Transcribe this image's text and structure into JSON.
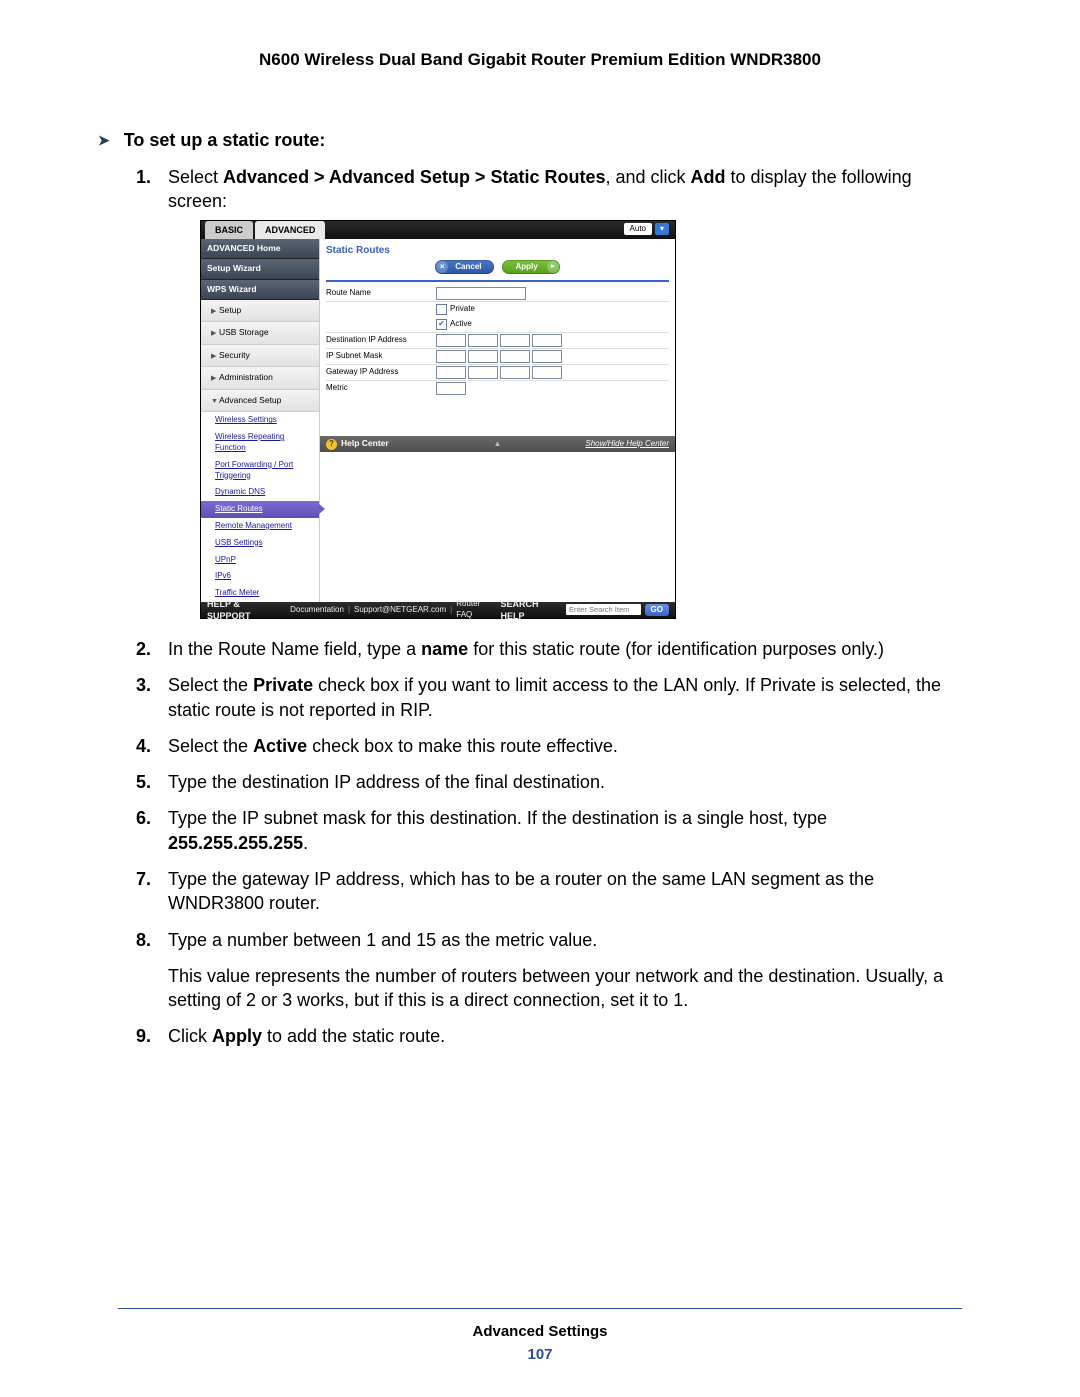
{
  "header": "N600 Wireless Dual Band Gigabit Router Premium Edition WNDR3800",
  "heading": "To set up a static route:",
  "steps": {
    "s1a": "Select ",
    "s1b": "Advanced > Advanced Setup > Static Routes",
    "s1c": ", and click ",
    "s1d": "Add",
    "s1e": " to display the following screen:",
    "s2a": "In the Route Name field, type a ",
    "s2b": "name",
    "s2c": " for this static route (for identification purposes only.)",
    "s3a": "Select the ",
    "s3b": "Private",
    "s3c": " check box if you want to limit access to the LAN only. If Private is selected, the static route is not reported in RIP.",
    "s4a": "Select the ",
    "s4b": "Active",
    "s4c": " check box to make this route effective.",
    "s5": "Type the destination IP address of the final destination.",
    "s6a": "Type the IP subnet mask for this destination. If the destination is a single host, type ",
    "s6b": "255.255.255.255",
    "s6c": ".",
    "s7": "Type the gateway IP address, which has to be a router on the same LAN segment as the WNDR3800 router.",
    "s8a": "Type a number between 1 and 15 as the metric value.",
    "s8b": "This value represents the number of routers between your network and the destination. Usually, a setting of 2 or 3 works, but if this is a direct connection, set it to 1.",
    "s9a": "Click ",
    "s9b": "Apply",
    "s9c": " to add the static route."
  },
  "footer": {
    "label": "Advanced Settings",
    "page": "107"
  },
  "ui": {
    "tabs": {
      "basic": "BASIC",
      "advanced": "ADVANCED"
    },
    "auto": "Auto",
    "sidebar": {
      "home": "ADVANCED Home",
      "setup_wizard": "Setup Wizard",
      "wps": "WPS Wizard",
      "setup": "Setup",
      "usb": "USB Storage",
      "security": "Security",
      "admin": "Administration",
      "adv_setup": "Advanced Setup",
      "subs": {
        "wireless": "Wireless Settings",
        "repeating": "Wireless Repeating Function",
        "portfwd": "Port Forwarding / Port Triggering",
        "ddns": "Dynamic DNS",
        "static": "Static Routes",
        "remote": "Remote Management",
        "usbset": "USB Settings",
        "upnp": "UPnP",
        "ipv6": "IPv6",
        "traffic": "Traffic Meter"
      }
    },
    "main": {
      "title": "Static Routes",
      "cancel": "Cancel",
      "apply": "Apply",
      "route_name": "Route Name",
      "private": "Private",
      "active": "Active",
      "dest": "Destination IP Address",
      "mask": "IP Subnet Mask",
      "gw": "Gateway IP Address",
      "metric": "Metric"
    },
    "help": {
      "title": "Help Center",
      "show": "Show/Hide Help Center"
    },
    "footer": {
      "hs": "HELP & SUPPORT",
      "doc": "Documentation",
      "sup": "Support@NETGEAR.com",
      "faq": "Router FAQ",
      "sh": "SEARCH HELP",
      "placeholder": "Enter Search Item",
      "go": "GO"
    }
  }
}
